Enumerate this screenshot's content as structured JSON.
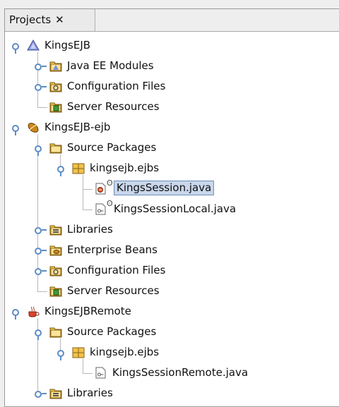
{
  "tab": {
    "label": "Projects",
    "close": "✕"
  },
  "tree": [
    {
      "label": "KingsEJB",
      "icon": "enterprise-project-icon",
      "depth": 0,
      "handle": "open"
    },
    {
      "label": "Java EE Modules",
      "icon": "module-folder-icon",
      "depth": 1,
      "handle": "closed"
    },
    {
      "label": "Configuration Files",
      "icon": "config-folder-icon",
      "depth": 1,
      "handle": "closed"
    },
    {
      "label": "Server Resources",
      "icon": "server-folder-icon",
      "depth": 1,
      "handle": "none"
    },
    {
      "label": "KingsEJB-ejb",
      "icon": "ejb-project-icon",
      "depth": 0,
      "handle": "open"
    },
    {
      "label": "Source Packages",
      "icon": "source-folder-icon",
      "depth": 1,
      "handle": "open"
    },
    {
      "label": "kingsejb.ejbs",
      "icon": "package-icon",
      "depth": 2,
      "handle": "open"
    },
    {
      "label": "KingsSession.java",
      "icon": "java-session-bean-icon",
      "depth": 3,
      "handle": "none",
      "selected": true,
      "link": true
    },
    {
      "label": "KingsSessionLocal.java",
      "icon": "java-interface-icon",
      "depth": 3,
      "handle": "none",
      "link": true
    },
    {
      "label": "Libraries",
      "icon": "libraries-folder-icon",
      "depth": 1,
      "handle": "closed"
    },
    {
      "label": "Enterprise Beans",
      "icon": "beans-folder-icon",
      "depth": 1,
      "handle": "closed"
    },
    {
      "label": "Configuration Files",
      "icon": "config-folder-icon",
      "depth": 1,
      "handle": "closed"
    },
    {
      "label": "Server Resources",
      "icon": "server-folder-icon",
      "depth": 1,
      "handle": "none"
    },
    {
      "label": "KingsEJBRemote",
      "icon": "java-library-project-icon",
      "depth": 0,
      "handle": "open"
    },
    {
      "label": "Source Packages",
      "icon": "source-folder-icon",
      "depth": 1,
      "handle": "open"
    },
    {
      "label": "kingsejb.ejbs",
      "icon": "package-icon",
      "depth": 2,
      "handle": "open"
    },
    {
      "label": "KingsSessionRemote.java",
      "icon": "java-interface-icon",
      "depth": 3,
      "handle": "none"
    },
    {
      "label": "Libraries",
      "icon": "libraries-folder-icon",
      "depth": 1,
      "handle": "closed"
    }
  ]
}
